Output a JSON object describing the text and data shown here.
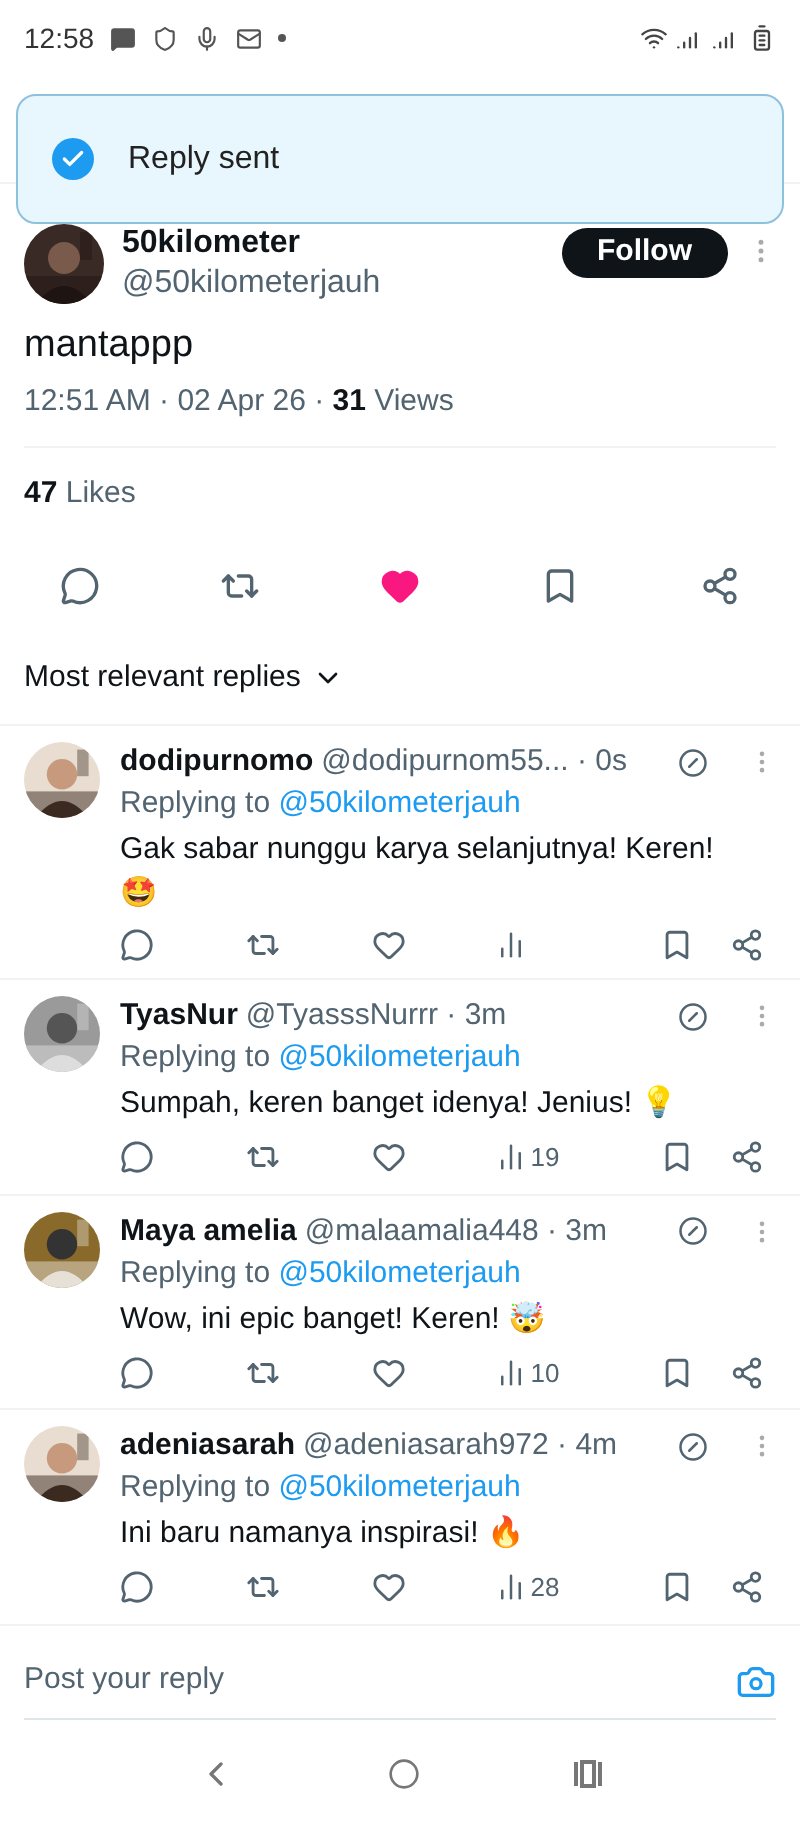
{
  "status_bar": {
    "time": "12:58"
  },
  "toast": {
    "text": "Reply sent"
  },
  "post": {
    "author_name": "50kilometer",
    "handle": "@50kilometerjauh",
    "follow_label": "Follow",
    "text": "mantappp",
    "time": "12:51 AM · 02 Apr 26 · ",
    "views_count": "31",
    "views_label": " Views",
    "likes_count": "47",
    "likes_label": " Likes",
    "liked": true,
    "bookmarked": false
  },
  "sort": {
    "label": "Most relevant replies"
  },
  "replies": [
    {
      "name": "dodipurnomo",
      "handle": "@dodipurnom55...",
      "time": " · 0s",
      "replying_prefix": "Replying to ",
      "replying_to": "@50kilometerjauh",
      "text": "Gak sabar nunggu karya selanjutnya! Keren! 🤩",
      "liked": false
    },
    {
      "name": "TyasNur",
      "handle": "@TyasssNurrr",
      "time": " · 3m",
      "replying_prefix": "Replying to ",
      "replying_to": "@50kilometerjauh",
      "text": "Sumpah, keren banget idenya! Jenius! 💡",
      "views": "19",
      "liked": false
    },
    {
      "name": "Maya amelia",
      "handle": "@malaamalia448",
      "time": " · 3m",
      "replying_prefix": "Replying to ",
      "replying_to": "@50kilometerjauh",
      "text": "Wow, ini epic banget! Keren! 🤯",
      "views": "10",
      "liked": false
    },
    {
      "name": "adeniasarah",
      "handle": "@adeniasarah972",
      "time": " · 4m",
      "replying_prefix": "Replying to ",
      "replying_to": "@50kilometerjauh",
      "text": "Ini baru namanya inspirasi! 🔥",
      "views": "28",
      "liked": false
    }
  ],
  "composer": {
    "placeholder": "Post your reply"
  }
}
